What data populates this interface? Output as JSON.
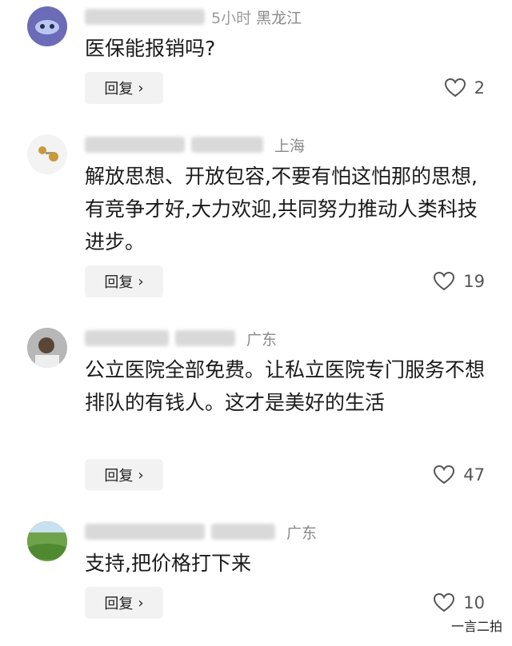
{
  "reply_label": "回复",
  "comments": [
    {
      "location": "黑龙江",
      "name_fragment": "5小时",
      "text": "医保能报销吗?",
      "likes": "2"
    },
    {
      "location": "上海",
      "text": "解放思想、开放包容,不要有怕这怕那的思想,有竞争才好,大力欢迎,共同努力推动人类科技进步。",
      "likes": "19"
    },
    {
      "location": "广东",
      "text": "公立医院全部免费。让私立医院专门服务不想排队的有钱人。这才是美好的生活",
      "likes": "47"
    },
    {
      "location": "广东",
      "text": "支持,把价格打下来",
      "likes": "10"
    }
  ],
  "watermark": "一言二拍",
  "icons": {
    "like": "heart-outline-icon",
    "reply": "chevron-right-icon"
  }
}
